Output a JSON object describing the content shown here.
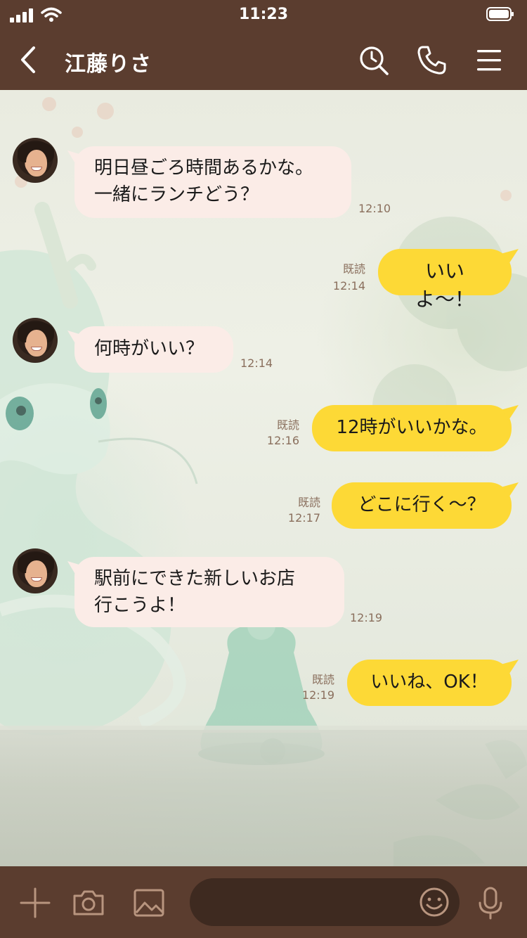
{
  "status": {
    "time": "11:23"
  },
  "header": {
    "title": "江藤りさ"
  },
  "messages": [
    {
      "side": "in",
      "lines": "明日昼ごろ時間あるかな。\n一緒にランチどう？",
      "time": "12:10"
    },
    {
      "side": "out",
      "text": "いいよ〜！",
      "read": "既読",
      "time": "12:14"
    },
    {
      "side": "in",
      "lines": "何時がいい？",
      "time": "12:14"
    },
    {
      "side": "out",
      "text": "12時がいいかな。",
      "read": "既読",
      "time": "12:16"
    },
    {
      "side": "out",
      "text": "どこに行く〜？",
      "read": "既読",
      "time": "12:17"
    },
    {
      "side": "in",
      "lines": "駅前にできた新しいお店\n行こうよ！",
      "time": "12:19"
    },
    {
      "side": "out",
      "text": "いいね、OK！",
      "read": "既読",
      "time": "12:19"
    }
  ],
  "icons": {
    "back": "back-chevron-icon",
    "search": "search-icon",
    "call": "phone-icon",
    "menu": "menu-icon",
    "plus": "plus-icon",
    "camera": "camera-icon",
    "image": "image-icon",
    "emoji": "emoji-icon",
    "mic": "microphone-icon"
  },
  "colors": {
    "bar": "#5b3d2f",
    "incoming_bubble": "#fbece7",
    "outgoing_bubble": "#fdd936",
    "meta_text": "#8a6f5d"
  }
}
